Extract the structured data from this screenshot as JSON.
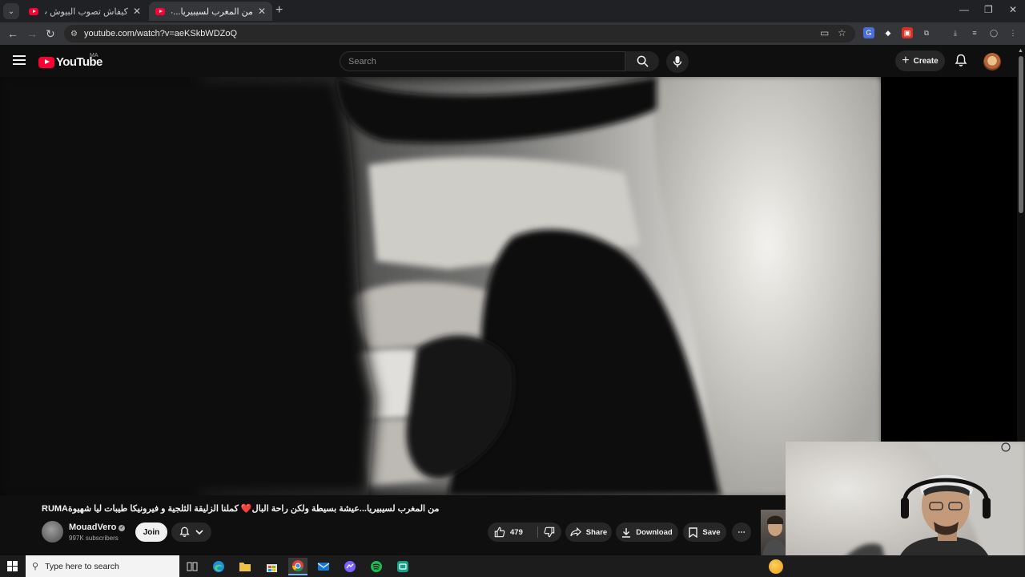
{
  "browser": {
    "tabs": [
      {
        "title": "كيفاش تصوب البيوش ب الاعشاب",
        "active": false
      },
      {
        "title": "من المغرب لسيبيريا...عيشة بسيطة",
        "active": true
      }
    ],
    "url": "youtube.com/watch?v=aeKSkbWDZoQ",
    "new_tab": "+",
    "window_controls": {
      "minimize": "—",
      "restore": "❐",
      "close": "✕"
    }
  },
  "youtube": {
    "logo_text": "YouTube",
    "country_code": "MA",
    "search_placeholder": "Search",
    "create_label": "Create"
  },
  "video": {
    "title": "RUMAمن المغرب لسيبيريا...عيشة بسيطة ولكن راحة البال❤️ كملنا الزليقة الثلجية و فيرونيكا طيبات ليا شهيوة",
    "channel_name": "MouadVero",
    "subscribers": "997K subscribers",
    "join_label": "Join",
    "like_count": "479",
    "share_label": "Share",
    "download_label": "Download",
    "save_label": "Save"
  },
  "taskbar": {
    "search_placeholder": "Type here to search"
  },
  "colors": {
    "brand_red": "#ff0033",
    "page_bg": "#0f0f0f",
    "pill_bg": "#272727"
  }
}
